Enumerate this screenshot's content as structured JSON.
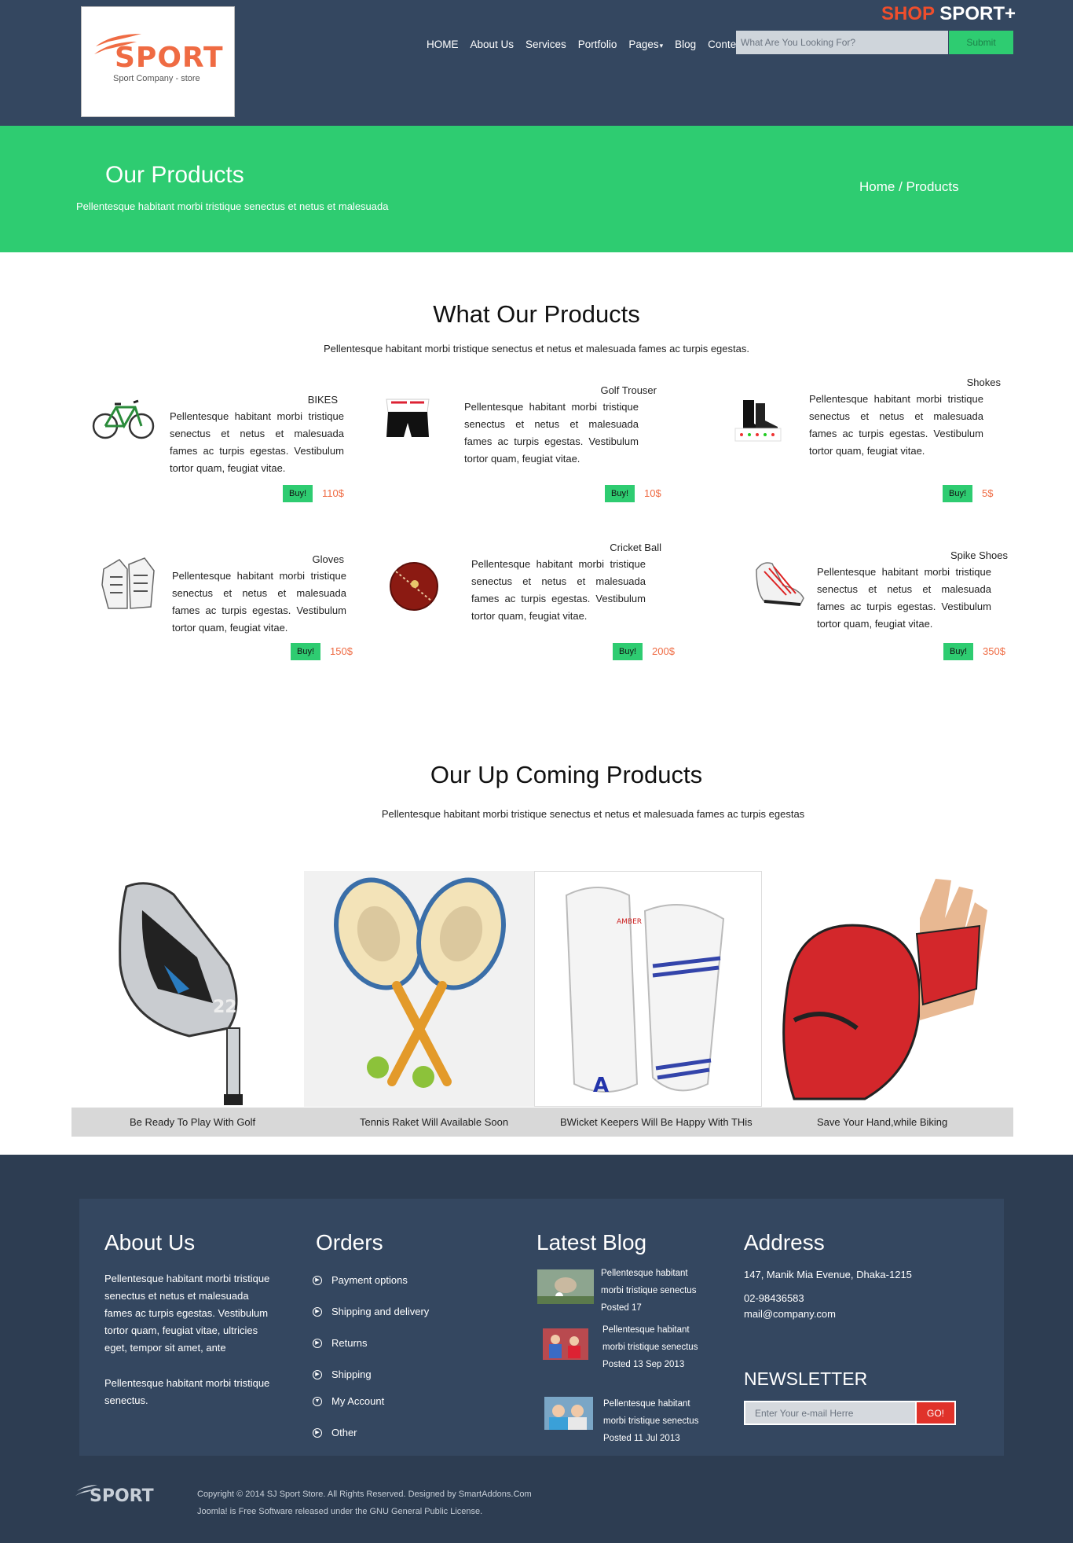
{
  "header": {
    "logo_word": "SPORT",
    "logo_tagline": "Sport Company - store",
    "brand_shop": "SHOP",
    "brand_sport": "SPORT+",
    "nav": [
      "HOME",
      "About Us",
      "Services",
      "Portfolio",
      "Pages",
      "Blog",
      "Content"
    ],
    "search_placeholder": "What Are You Looking For?",
    "search_button": "Submit"
  },
  "hero": {
    "title": "Our Products",
    "subtitle": "Pellentesque habitant morbi tristique senectus et netus et malesuada",
    "breadcrumb_home": "Home /",
    "breadcrumb_current": "Products"
  },
  "products_section": {
    "title": "What Our Products",
    "subtitle": "Pellentesque habitant morbi tristique senectus et netus et malesuada fames ac turpis egestas.",
    "buy_label": "Buy!",
    "description": "Pellentesque habitant morbi tristique senectus et netus et malesuada fames ac turpis egestas. Vestibulum tortor quam, feugiat vitae.",
    "items": [
      {
        "name": "BIKES",
        "price": "110$",
        "image": "bicycle-icon"
      },
      {
        "name": "Golf Trouser",
        "price": "10$",
        "image": "shorts-icon"
      },
      {
        "name": "Shokes",
        "price": "5$",
        "image": "socks-icon"
      },
      {
        "name": "Gloves",
        "price": "150$",
        "image": "glove-icon"
      },
      {
        "name": "Cricket Ball",
        "price": "200$",
        "image": "cricket-ball-icon"
      },
      {
        "name": "Spike Shoes",
        "price": "350$",
        "image": "shoe-icon"
      }
    ]
  },
  "upcoming_section": {
    "title": "Our Up Coming Products",
    "subtitle": "Pellentesque habitant morbi tristique senectus et netus et malesuada fames ac turpis egestas",
    "items": [
      {
        "caption": "Be Ready To Play With Golf",
        "image": "golf-club-icon"
      },
      {
        "caption": "Tennis Raket Will Available Soon",
        "image": "tennis-racket-icon"
      },
      {
        "caption": "BWicket Keepers Will Be Happy With THis",
        "image": "leg-pads-icon"
      },
      {
        "caption": "Save Your Hand,while Biking",
        "image": "boxing-glove-icon"
      }
    ]
  },
  "footer": {
    "about_title": "About Us",
    "about_text_1": "Pellentesque habitant morbi tristique senectus et netus et malesuada fames ac turpis egestas. Vestibulum tortor quam, feugiat vitae, ultricies eget, tempor sit amet, ante",
    "about_text_2": "Pellentesque habitant morbi tristique senectus.",
    "orders_title": "Orders",
    "orders": [
      "Payment options",
      "Shipping and delivery",
      "Returns",
      "Shipping",
      "My Account",
      "Other"
    ],
    "blog_title": "Latest Blog",
    "blog": [
      "Pellentesque habitant morbi tristique senectus Posted 17",
      "Pellentesque habitant morbi tristique senectus Posted 13 Sep 2013",
      "Pellentesque habitant morbi tristique senectus Posted 11 Jul 2013"
    ],
    "address_title": "Address",
    "address": "147, Manik Mia Evenue, Dhaka-1215",
    "phone": "02-98436583",
    "email": "mail@company.com",
    "newsletter_title": "NEWSLETTER",
    "newsletter_placeholder": "Enter Your e-mail Herre",
    "newsletter_button": "GO!",
    "footer_logo": "SPORT",
    "copyright": "Copyright © 2014 SJ Sport Store. All Rights Reserved. Designed by SmartAddons.Com",
    "license": "Joomla! is Free Software released under the GNU General Public License."
  },
  "colors": {
    "header_bg": "#344760",
    "accent_green": "#2ecc71",
    "accent_orange": "#ef6b43",
    "footer_bg": "#2d3d52",
    "go_red": "#e0322a"
  }
}
